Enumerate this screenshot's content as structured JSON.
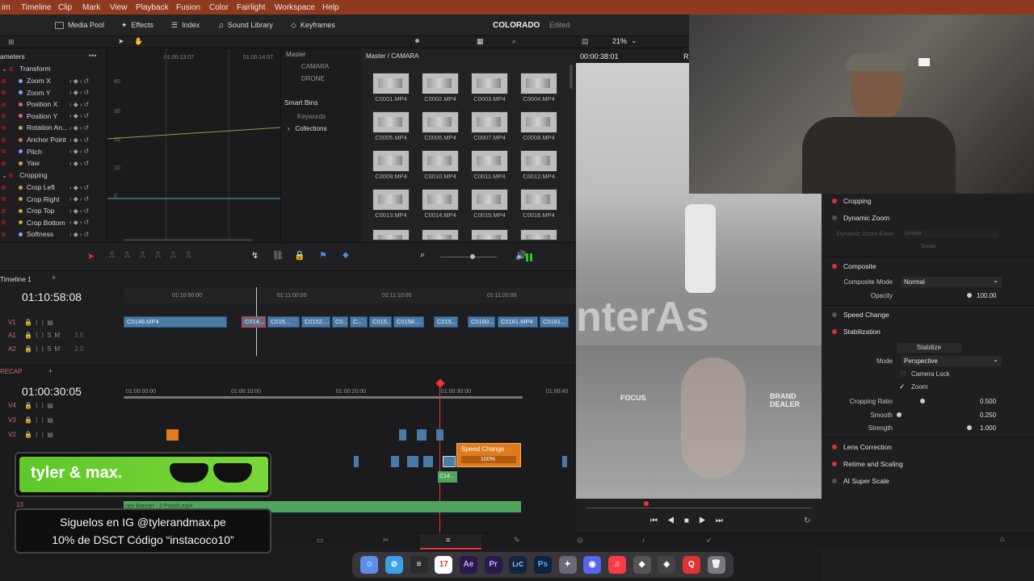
{
  "menu": [
    "im",
    "Timeline",
    "Clip",
    "Mark",
    "View",
    "Playback",
    "Fusion",
    "Color",
    "Fairlight",
    "Workspace",
    "Help"
  ],
  "toolbar": {
    "media_pool": "Media Pool",
    "effects": "Effects",
    "index": "Index",
    "sound_library": "Sound Library",
    "keyframes": "Keyframes",
    "project": "COLORADO",
    "edited": "Edited",
    "zoom": "21%",
    "timecode": "00:00:38:01",
    "r_label": "R"
  },
  "params": {
    "header": "ameters",
    "times": [
      "01:00:13:07",
      "01:00:14:07"
    ],
    "y_ticks": [
      "40",
      "30",
      "20",
      "10",
      "0"
    ],
    "transform": "Transform",
    "items": [
      "Zoom X",
      "Zoom Y",
      "Position X",
      "Position Y",
      "Rotation An...",
      "Anchor Point",
      "Pitch",
      "Yaw"
    ],
    "cropping": "Cropping",
    "crop_items": [
      "Crop Left",
      "Crop Right",
      "Crop Top",
      "Crop Bottom",
      "Softness"
    ]
  },
  "bins": {
    "master": "Master",
    "sub": [
      "CAMARA",
      "DRONE"
    ],
    "smart_bins": "Smart Bins",
    "keywords": "Keywords",
    "collections": "Collections",
    "path": "Master / CAMARA"
  },
  "clips": [
    "C0001.MP4",
    "C0002.MP4",
    "C0003.MP4",
    "C0004.MP4",
    "C0005.MP4",
    "C0006.MP4",
    "C0007.MP4",
    "C0008.MP4",
    "C0009.MP4",
    "C0010.MP4",
    "C0011.MP4",
    "C0012.MP4",
    "C0013.MP4",
    "C0014.MP4",
    "C0015.MP4",
    "C0016.MP4"
  ],
  "timeline1": {
    "name": "Timeline 1",
    "tc": "01:10:58:08",
    "ruler": [
      "01:10:50:00",
      "01:11:00:00",
      "01:11:10:00",
      "01:11:20:00"
    ],
    "tracks": [
      "V1",
      "A1",
      "A2"
    ],
    "vol": [
      "2.0",
      "2.0"
    ],
    "clips": [
      "C0148.MP4",
      "C014...",
      "C015...",
      "C0152....",
      "C0...",
      "C...",
      "C015...",
      "C0158...",
      "C015...",
      "C0160...",
      "C0161.MP4",
      "C0161..."
    ]
  },
  "timeline2": {
    "name": "RECAP",
    "tc": "01:00:30:05",
    "ruler": [
      "01:00:00:00",
      "01:00:10:00",
      "01:00:20:00",
      "01:00:30:00",
      "01:00:40"
    ],
    "tracks": [
      "V4",
      "V3",
      "V2"
    ],
    "speed_title": "Speed Change",
    "speed_val": "100%",
    "clip": "C14...",
    "banner_clip": "nex Banner - 2 Punch.mp4",
    "v_label": "13"
  },
  "overlay": {
    "logo": "tyler & max.",
    "ig": "Siguelos en IG @tylerandmax.pe",
    "promo": "10% de DSCT Código “instacoco10”"
  },
  "inspector": {
    "cropping": "Cropping",
    "dynamic_zoom": "Dynamic Zoom",
    "dz_ease": "Dynamic Zoom Ease",
    "dz_ease_val": "Linear",
    "swap": "Swap",
    "composite": "Composite",
    "comp_mode": "Composite Mode",
    "comp_mode_val": "Normal",
    "opacity": "Opacity",
    "opacity_val": "100.00",
    "speed_change": "Speed Change",
    "stabilization": "Stabilization",
    "stabilize": "Stabilize",
    "mode": "Mode",
    "mode_val": "Perspective",
    "camera_lock": "Camera Lock",
    "zoom": "Zoom",
    "cropping_ratio": "Cropping Ratio",
    "cropping_ratio_val": "0.500",
    "smooth": "Smooth",
    "smooth_val": "0.250",
    "strength": "Strength",
    "strength_val": "1.000",
    "lens_correction": "Lens Correction",
    "retime": "Retime and Scaling",
    "ai_super": "AI Super Scale"
  },
  "preview": {
    "signs": [
      "FOCUS",
      "BRAND DEALER"
    ],
    "banner_text": "nterAs"
  },
  "dock": [
    "17",
    "Ae",
    "Pr",
    "LrC",
    "Ps"
  ],
  "colors": {
    "menubar": "#8e3a1f",
    "accent_red": "#d33",
    "clip_blue": "#4a7aa6",
    "green_clip": "#4fa55d",
    "orange": "#e07a1d"
  }
}
